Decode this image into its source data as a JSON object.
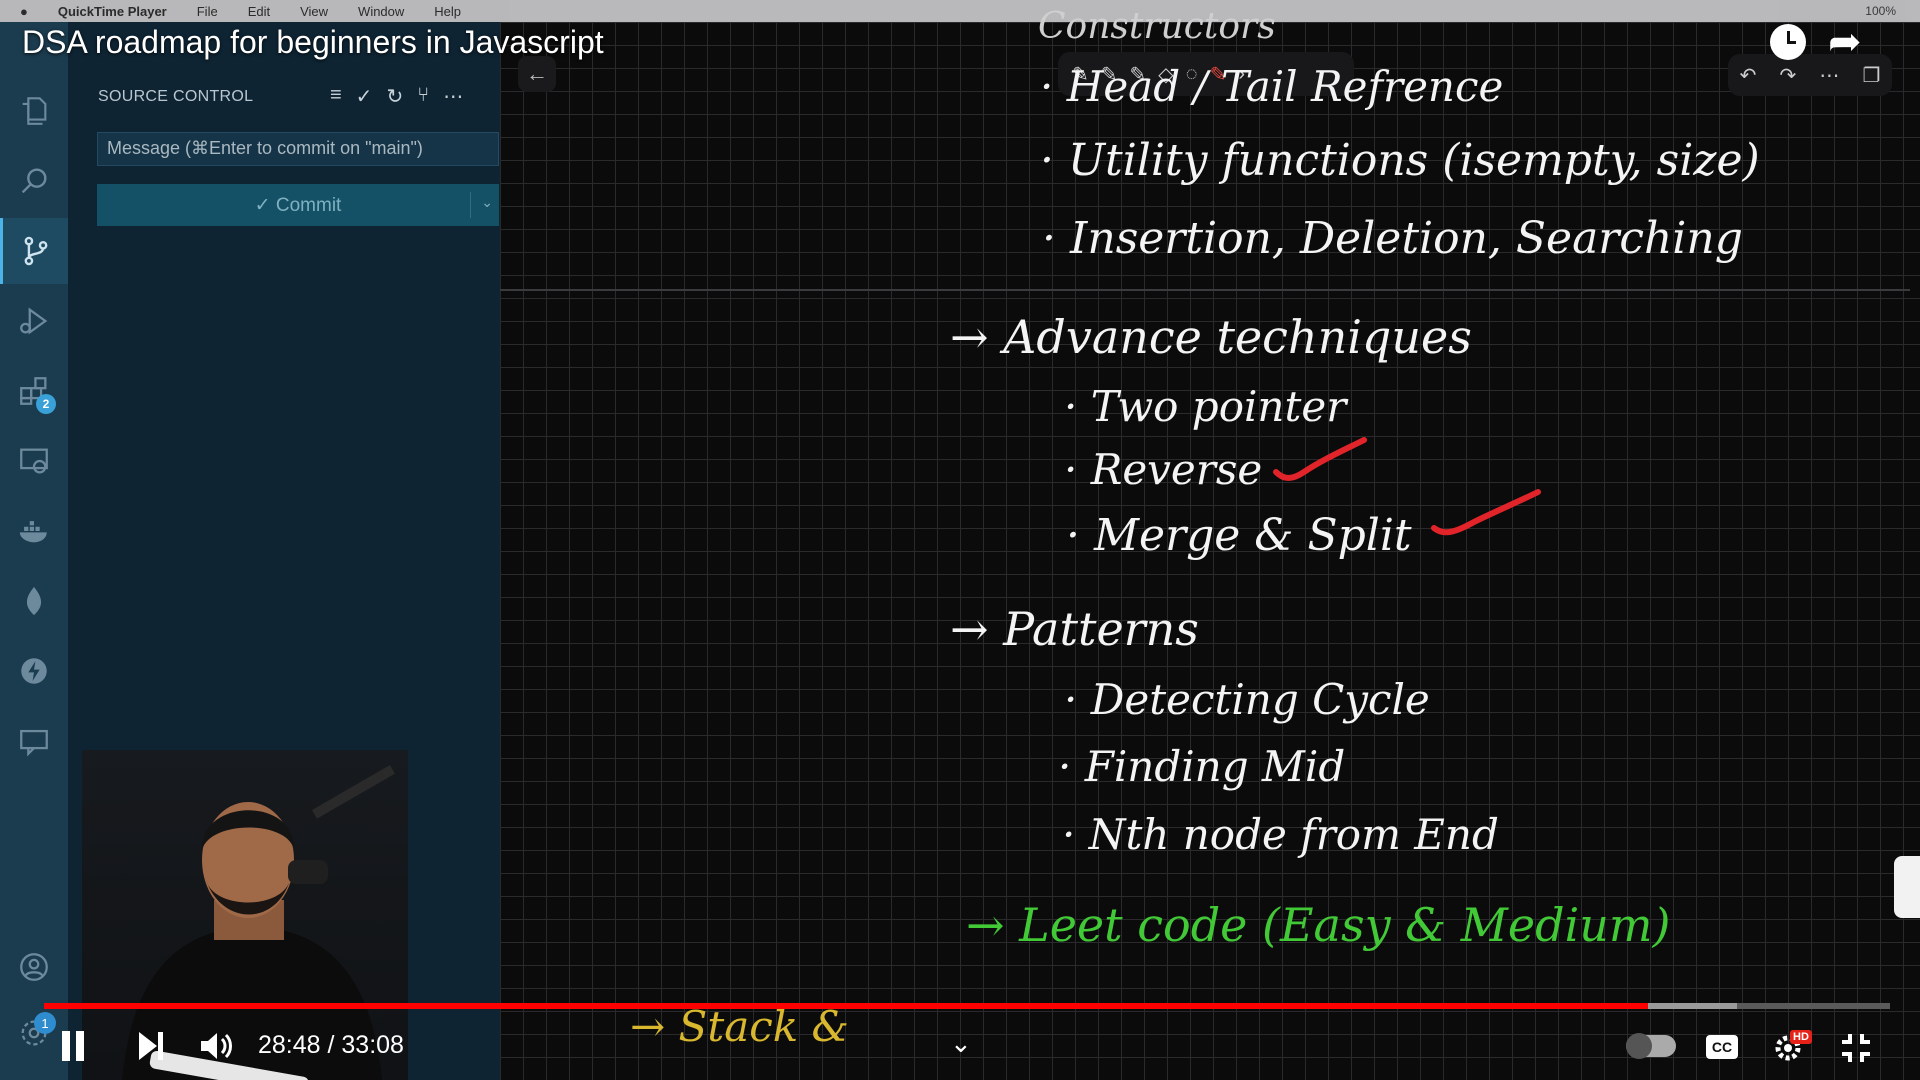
{
  "menubar": {
    "app": "QuickTime Player",
    "items": [
      "File",
      "Edit",
      "View",
      "Window",
      "Help"
    ],
    "right": [
      "100%"
    ]
  },
  "video": {
    "title": "DSA roadmap for beginners in Javascript",
    "time_label": "28:48 / 33:08",
    "progress_fraction": 0.869,
    "buffered_fraction": 0.917,
    "cc_label": "CC",
    "hd_label": "HD",
    "notification_count": "1"
  },
  "vscode": {
    "extensions_badge": "2",
    "source_control": {
      "header": "SOURCE CONTROL",
      "message_placeholder": "Message (⌘Enter to commit on \"main\")",
      "commit_label": "✓ Commit"
    }
  },
  "whiteboard": {
    "partial_top": "Constructors",
    "lines": [
      {
        "id": "head-tail",
        "text": "· Head / Tail Refrence",
        "color": "white"
      },
      {
        "id": "utility",
        "text": "· Utility functions (isempty, size)",
        "color": "white"
      },
      {
        "id": "insertion",
        "text": "· Insertion, Deletion, Searching",
        "color": "white"
      },
      {
        "id": "advance",
        "text": "→ Advance techniques",
        "color": "white"
      },
      {
        "id": "two-pointer",
        "text": "· Two pointer",
        "color": "white"
      },
      {
        "id": "reverse",
        "text": "· Reverse",
        "color": "white"
      },
      {
        "id": "merge",
        "text": "· Merge & Split",
        "color": "white"
      },
      {
        "id": "patterns",
        "text": "→ Patterns",
        "color": "white"
      },
      {
        "id": "detecting",
        "text": "· Detecting Cycle",
        "color": "white"
      },
      {
        "id": "finding",
        "text": "· Finding Mid",
        "color": "white"
      },
      {
        "id": "nth",
        "text": "· Nth node from End",
        "color": "white"
      },
      {
        "id": "leetcode",
        "text": "→ Leet code (Easy & Medium)",
        "color": "#42c936"
      },
      {
        "id": "stack",
        "text": "→ Stack &",
        "color": "#d9b72e"
      }
    ],
    "checked": [
      "reverse",
      "merge"
    ]
  },
  "colors": {
    "accent_red": "#ff0000",
    "tick_red": "#e0242a",
    "leetcode_green": "#42c936",
    "stack_yellow": "#d9b72e"
  }
}
